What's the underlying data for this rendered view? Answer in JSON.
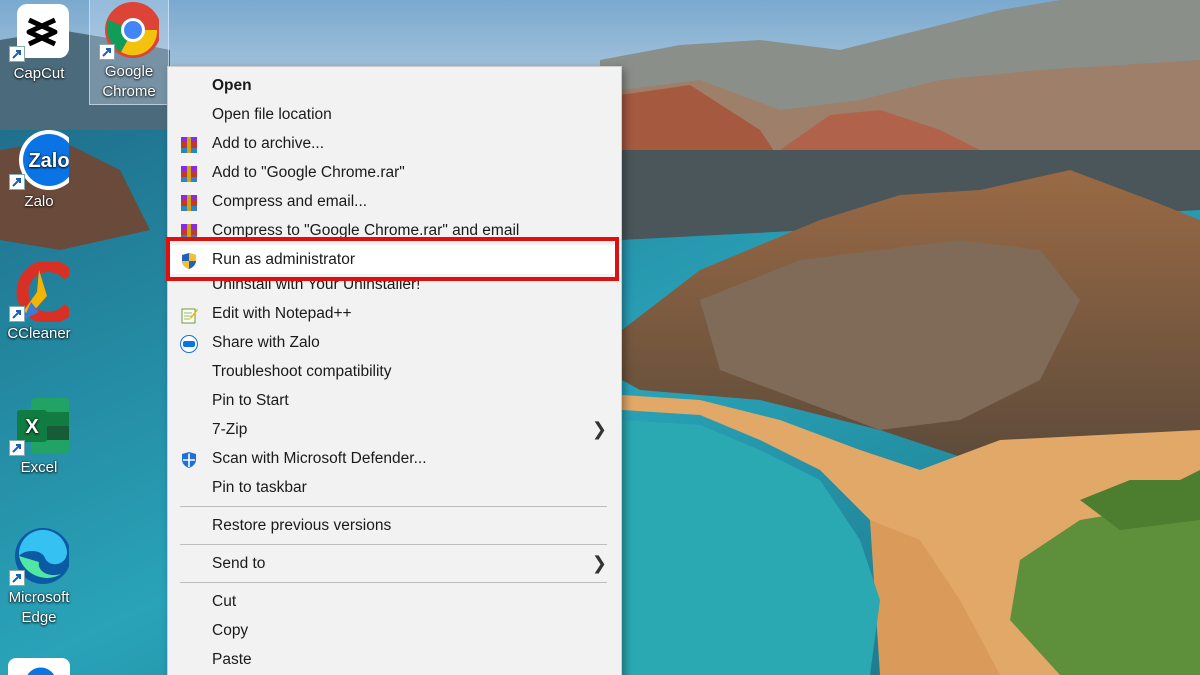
{
  "desktop": {
    "icons": [
      {
        "label": "CapCut",
        "icon": "capcut-icon"
      },
      {
        "label": "Google Chrome",
        "icon": "chrome-icon",
        "selected": true
      },
      {
        "label": "Zalo",
        "icon": "zalo-icon"
      },
      {
        "label": "CCleaner",
        "icon": "ccleaner-icon"
      },
      {
        "label": "Excel",
        "icon": "excel-icon"
      },
      {
        "label": "Microsoft Edge",
        "icon": "edge-icon"
      }
    ],
    "zalo_text": "Zalo"
  },
  "context_menu": {
    "items": [
      {
        "label": "Open",
        "bold": true
      },
      {
        "label": "Open file location"
      },
      {
        "label": "Add to archive...",
        "icon": "winrar-icon"
      },
      {
        "label": "Add to \"Google Chrome.rar\"",
        "icon": "winrar-icon"
      },
      {
        "label": "Compress and email...",
        "icon": "winrar-icon"
      },
      {
        "label": "Compress to \"Google Chrome.rar\" and email",
        "icon": "winrar-icon"
      },
      {
        "label": "Run as administrator",
        "icon": "uac-shield-icon",
        "highlighted": true
      },
      {
        "label": "Uninstall with Your Uninstaller!"
      },
      {
        "label": "Edit with Notepad++",
        "icon": "notepadpp-icon"
      },
      {
        "label": "Share with Zalo",
        "icon": "zalo-icon"
      },
      {
        "label": "Troubleshoot compatibility"
      },
      {
        "label": "Pin to Start"
      },
      {
        "label": "7-Zip",
        "submenu": true
      },
      {
        "label": "Scan with Microsoft Defender...",
        "icon": "defender-icon"
      },
      {
        "label": "Pin to taskbar"
      },
      {
        "label": "Restore previous versions"
      },
      {
        "label": "Send to",
        "submenu": true
      },
      {
        "label": "Cut"
      },
      {
        "label": "Copy"
      },
      {
        "label": "Paste"
      }
    ]
  },
  "colors": {
    "highlight_border": "#e01010",
    "menu_background": "#f2f2f2"
  }
}
